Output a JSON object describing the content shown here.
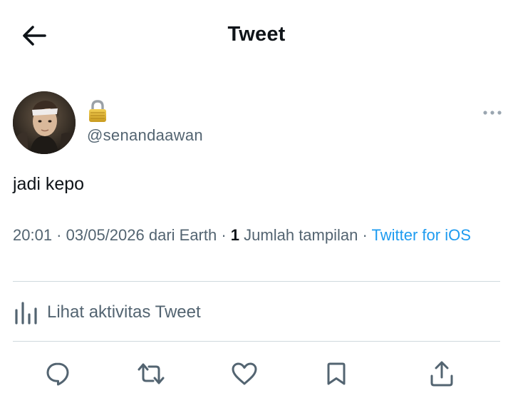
{
  "header": {
    "title": "Tweet",
    "back_icon": "arrow-left-icon"
  },
  "author": {
    "handle": "@senandaawan",
    "protected_icon": "lock-icon",
    "avatar": "profile-photo"
  },
  "tweet": {
    "text": "jadi kepo",
    "time": "20:01",
    "sep1": " · ",
    "date": "03/05/2026",
    "location": " dari Earth",
    "sep2": " · ",
    "views_count": "1",
    "views_label": " Jumlah tampilan",
    "sep3": " · ",
    "client": "Twitter for iOS"
  },
  "activity": {
    "label": "Lihat aktivitas Tweet",
    "icon": "bar-chart-icon"
  },
  "actions": {
    "reply_icon": "reply-icon",
    "retweet_icon": "retweet-icon",
    "like_icon": "heart-icon",
    "bookmark_icon": "bookmark-icon",
    "share_icon": "share-icon"
  },
  "colors": {
    "text": "#0f1419",
    "secondary": "#536471",
    "link": "#1d9bf0",
    "divider": "#cfd9de"
  }
}
